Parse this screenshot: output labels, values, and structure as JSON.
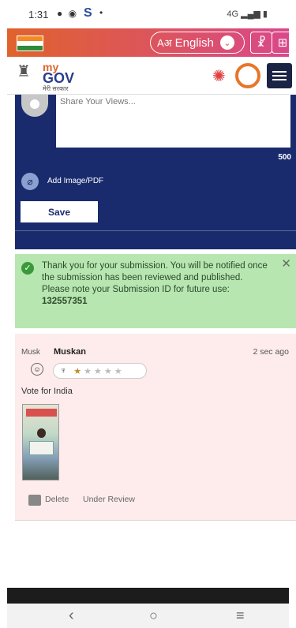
{
  "status_bar": {
    "time": "1:31",
    "indicators": "4G",
    "app_glyph": "S"
  },
  "top_bar": {
    "language_label": "English",
    "language_glyph": "Aअ",
    "accessibility_icon": "accessibility-icon",
    "add_user_icon": "add-user-icon"
  },
  "header": {
    "logo_my": "my",
    "logo_gov": "GOV",
    "logo_sub": "मेरी सरकार"
  },
  "form": {
    "placeholder": "Share Your Views...",
    "char_count": "500",
    "attach_label": "Add Image/PDF",
    "save_label": "Save"
  },
  "success": {
    "message": "Thank you for your submission. You will be notified once the submission has been reviewed and published.",
    "note": "Please note your Submission ID for future use:",
    "submission_id": "132557351",
    "close_glyph": "✕"
  },
  "comment": {
    "user_name": "Muskan",
    "avatar_alt": "Musk",
    "time_ago": "2 sec ago",
    "rating": 1,
    "rating_max": 5,
    "text": "Vote for India",
    "delete_label": "Delete",
    "status_label": "Under Review"
  },
  "colors": {
    "accent_orange": "#e0622c",
    "navy": "#1a2b6d",
    "success_bg": "#b7e6b0",
    "comment_bg": "#fdeceb"
  }
}
